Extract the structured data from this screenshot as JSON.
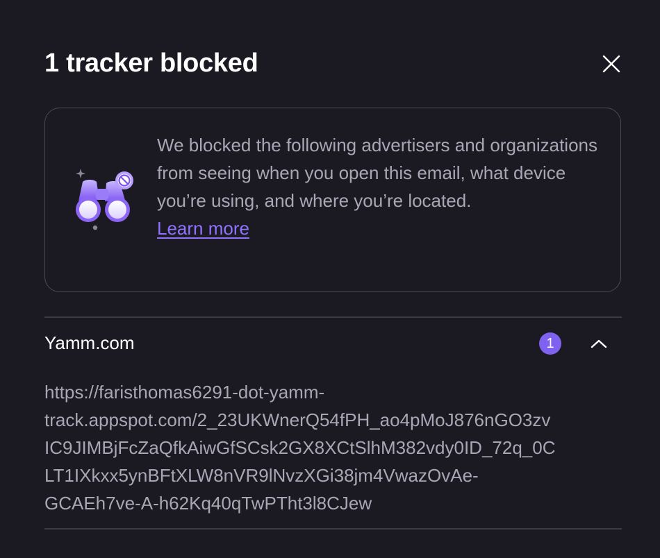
{
  "modal": {
    "title": "1 tracker blocked",
    "close_icon": "close-icon"
  },
  "info": {
    "illustration_icon": "binoculars-blocked-icon",
    "text": "We blocked the following advertisers and organizations from seeing when you open this email, what device you’re using, and where you’re located.",
    "learn_more_label": "Learn more",
    "colors": {
      "link": "#8f72ff",
      "text": "#a9a6b5"
    }
  },
  "trackers": [
    {
      "name": "Yamm.com",
      "count": "1",
      "expanded": true,
      "chevron_icon": "chevron-up-icon",
      "url_lines": "https://faristhomas6291-dot-yamm-\ntrack.appspot.com/2_23UKWnerQ54fPH_ao4pMoJ876nGO3zv\nIC9JIMBjFcZaQfkAiwGfSCsk2GX8XCtSlhM382vdy0ID_72q_0C\nLT1IXkxx5ynBFtXLW8nVR9lNvzXGi38jm4VwazOvAe-\nGCAEh7ve-A-h62Kq40qTwPTht3l8CJew"
    }
  ],
  "theme": {
    "background": "#1b1a22",
    "accent": "#7f62ef",
    "border": "#4c4a57"
  }
}
